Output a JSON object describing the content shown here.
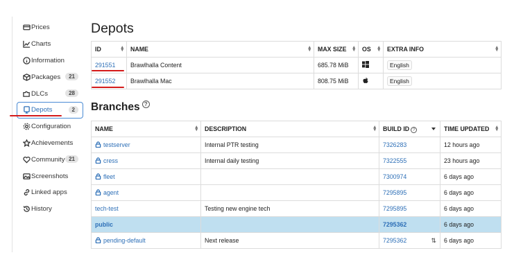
{
  "sidebar": {
    "items": [
      {
        "label": "Prices",
        "badge": ""
      },
      {
        "label": "Charts",
        "badge": ""
      },
      {
        "label": "Information",
        "badge": ""
      },
      {
        "label": "Packages",
        "badge": "21"
      },
      {
        "label": "DLCs",
        "badge": "28"
      },
      {
        "label": "Depots",
        "badge": "2"
      },
      {
        "label": "Configuration",
        "badge": ""
      },
      {
        "label": "Achievements",
        "badge": ""
      },
      {
        "label": "Community",
        "badge": "21"
      },
      {
        "label": "Screenshots",
        "badge": ""
      },
      {
        "label": "Linked apps",
        "badge": ""
      },
      {
        "label": "History",
        "badge": ""
      }
    ],
    "active": "Depots"
  },
  "depots": {
    "title": "Depots",
    "headers": [
      "ID",
      "NAME",
      "MAX SIZE",
      "OS",
      "EXTRA INFO"
    ],
    "rows": [
      {
        "id": "291551",
        "name": "Brawlhalla Content",
        "size": "685.78 MiB",
        "os": "windows-icon",
        "extra": "English"
      },
      {
        "id": "291552",
        "name": "Brawlhalla Mac",
        "size": "808.75 MiB",
        "os": "apple-icon",
        "extra": "English"
      }
    ]
  },
  "branches": {
    "title": "Branches",
    "headers": [
      "NAME",
      "DESCRIPTION",
      "BUILD ID",
      "TIME UPDATED"
    ],
    "rows": [
      {
        "name": "testserver",
        "locked": true,
        "desc": "Internal PTR testing",
        "build": "7326283",
        "time": "12 hours ago"
      },
      {
        "name": "cress",
        "locked": true,
        "desc": "Internal daily testing",
        "build": "7322555",
        "time": "23 hours ago"
      },
      {
        "name": "fleet",
        "locked": true,
        "desc": "",
        "build": "7300974",
        "time": "6 days ago"
      },
      {
        "name": "agent",
        "locked": true,
        "desc": "",
        "build": "7295895",
        "time": "6 days ago"
      },
      {
        "name": "tech-test",
        "locked": false,
        "desc": "Testing new engine tech",
        "build": "7295895",
        "time": "6 days ago"
      },
      {
        "name": "public",
        "locked": false,
        "desc": "",
        "build": "7295362",
        "time": "6 days ago",
        "highlight": true
      },
      {
        "name": "pending-default",
        "locked": true,
        "desc": "Next release",
        "build": "7295362",
        "time": "6 days ago",
        "history": true
      }
    ]
  },
  "colors": {
    "link": "#2d6fb7",
    "highlight_row": "#bfdff0",
    "annotation": "#d41a1a"
  }
}
